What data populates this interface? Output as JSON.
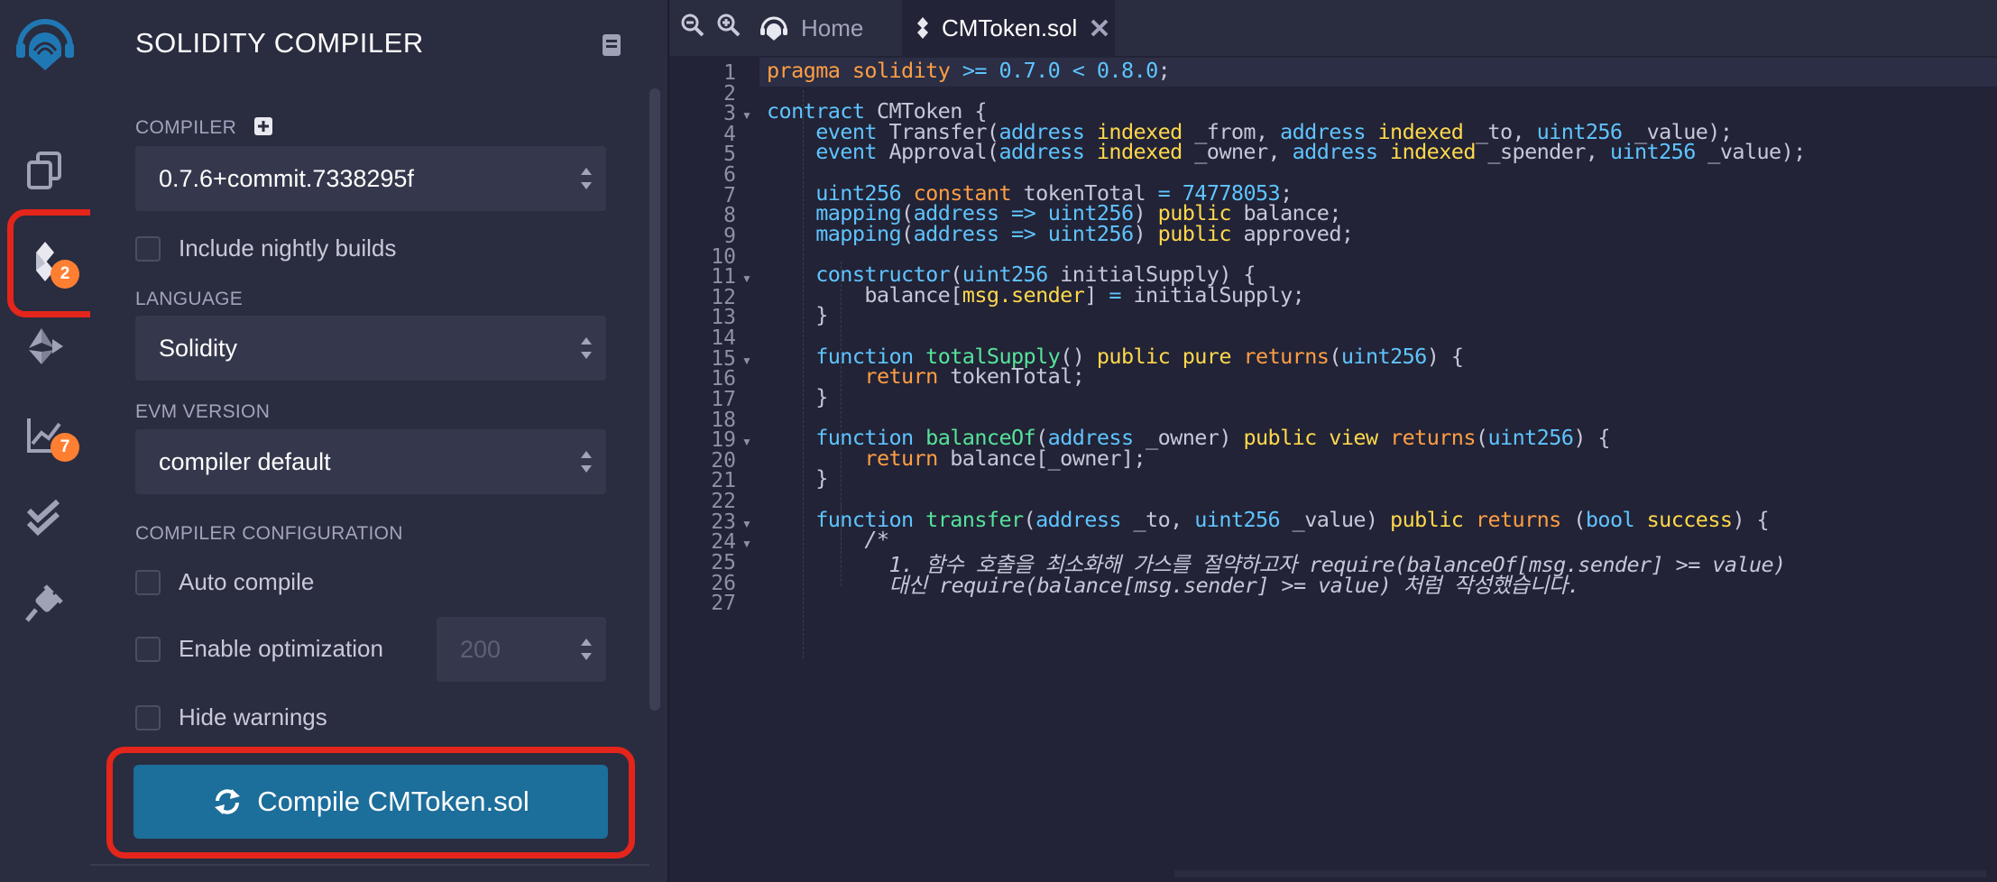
{
  "rail": {
    "items": [
      {
        "icon": "remix-logo-icon"
      },
      {
        "icon": "file-explorer-icon"
      },
      {
        "icon": "solidity-compiler-icon",
        "badge": "2"
      },
      {
        "icon": "deploy-run-icon"
      },
      {
        "icon": "analysis-icon",
        "badge": "7"
      },
      {
        "icon": "test-check-icon"
      },
      {
        "icon": "plugin-manager-icon"
      }
    ]
  },
  "panel": {
    "title": "SOLIDITY COMPILER",
    "compiler_label": "COMPILER",
    "compiler_value": "0.7.6+commit.7338295f",
    "nightly_label": "Include nightly builds",
    "language_label": "LANGUAGE",
    "language_value": "Solidity",
    "evm_label": "EVM VERSION",
    "evm_value": "compiler default",
    "config_label": "COMPILER CONFIGURATION",
    "auto_compile_label": "Auto compile",
    "optimization_label": "Enable optimization",
    "optimization_runs": "200",
    "hide_warnings_label": "Hide warnings",
    "compile_button": "Compile CMToken.sol"
  },
  "editor": {
    "tabs": [
      {
        "label": "Home"
      },
      {
        "label": "CMToken.sol"
      }
    ],
    "line_numbers": [
      "1",
      "2",
      "3",
      "4",
      "5",
      "6",
      "7",
      "8",
      "9",
      "10",
      "11",
      "12",
      "13",
      "14",
      "15",
      "16",
      "17",
      "18",
      "19",
      "20",
      "21",
      "22",
      "23",
      "24",
      "25",
      "26",
      "27"
    ],
    "code_lines": [
      "pragma solidity >= 0.7.0 < 0.8.0;",
      "",
      "contract CMToken {",
      "    event Transfer(address indexed _from, address indexed _to, uint256 _value);",
      "    event Approval(address indexed _owner, address indexed _spender, uint256 _value);",
      "",
      "    uint256 constant tokenTotal = 74778053;",
      "    mapping(address => uint256) public balance;",
      "    mapping(address => uint256) public approved;",
      "",
      "    constructor(uint256 initialSupply) {",
      "        balance[msg.sender] = initialSupply;",
      "    }",
      "",
      "    function totalSupply() public pure returns(uint256) {",
      "        return tokenTotal;",
      "    }",
      "",
      "    function balanceOf(address _owner) public view returns(uint256) {",
      "        return balance[_owner];",
      "    }",
      "",
      "    function transfer(address _to, uint256 _value) public returns (bool success) {",
      "        /*",
      "          1. 함수 호출을 최소화해 가스를 절약하고자 require(balanceOf[msg.sender] >= value)",
      "          대신 require(balance[msg.sender] >= value) 처럼 작성했습니다.",
      ""
    ]
  }
}
